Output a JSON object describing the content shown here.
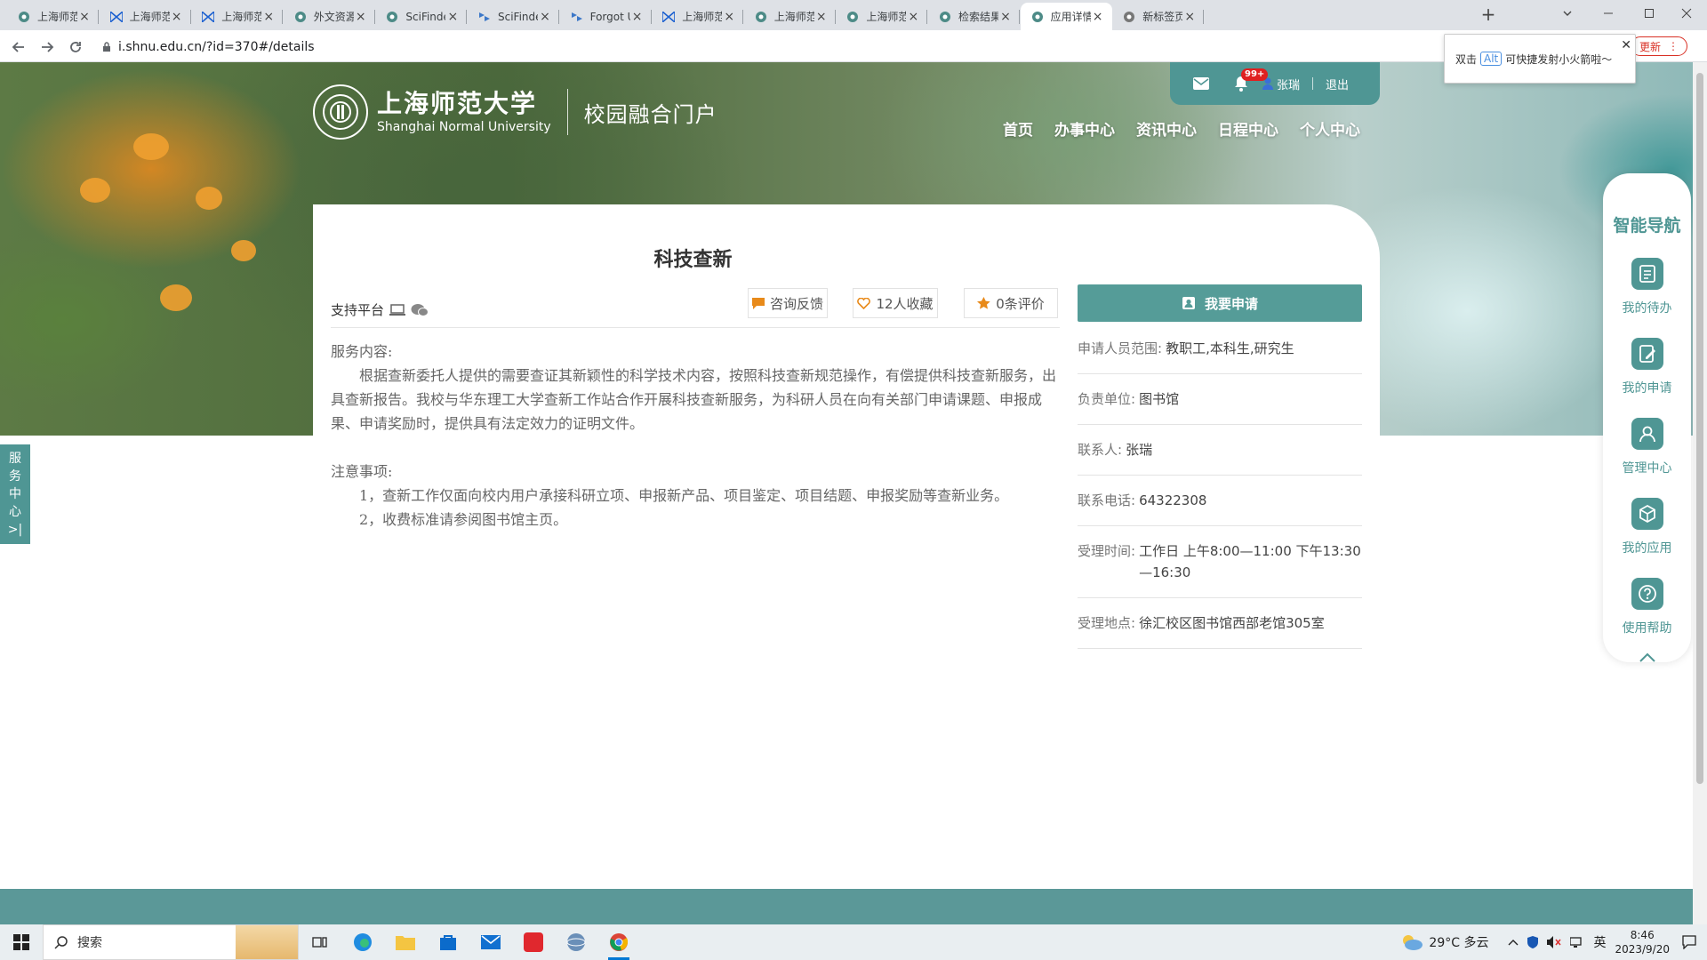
{
  "browser": {
    "tabs": [
      {
        "title": "上海师范大学",
        "icon": "globe-tab-icon"
      },
      {
        "title": "上海师范大学",
        "icon": "bowtie-tab-icon"
      },
      {
        "title": "上海师范大学",
        "icon": "bowtie-tab-icon"
      },
      {
        "title": "外文资源",
        "icon": "globe-tab-icon"
      },
      {
        "title": "SciFinder",
        "icon": "globe-tab-icon"
      },
      {
        "title": "SciFinder",
        "icon": "scifinder-tab-icon"
      },
      {
        "title": "Forgot User",
        "icon": "scifinder-tab-icon"
      },
      {
        "title": "上海师范大学",
        "icon": "bowtie-tab-icon"
      },
      {
        "title": "上海师范大学",
        "icon": "globe-tab-icon"
      },
      {
        "title": "上海师范大学",
        "icon": "globe-tab-icon"
      },
      {
        "title": "检索结果页",
        "icon": "globe-tab-icon"
      },
      {
        "title": "应用详情页",
        "icon": "globe-tab-icon",
        "active": true
      },
      {
        "title": "新标签页",
        "icon": "chrome-tab-icon"
      }
    ],
    "url": "i.shnu.edu.cn/?id=370#/details",
    "update_label": "更新"
  },
  "alt_popup": {
    "prefix": "双击",
    "key": "Alt",
    "suffix": "可快捷发射小火箭啦～"
  },
  "header": {
    "school_cn": "上海师范大学",
    "school_en": "Shanghai Normal University",
    "portal_name": "校园融合门户",
    "notif_badge": "99+",
    "user_name": "张瑞",
    "logout": "退出",
    "nav": [
      "首页",
      "办事中心",
      "资讯中心",
      "日程中心",
      "个人中心"
    ]
  },
  "service": {
    "title": "科技查新",
    "platform_label": "支持平台",
    "consult_label": "咨询反馈",
    "favorites_label": "12人收藏",
    "reviews_label": "0条评价",
    "apply_label": "我要申请",
    "content_heading": "服务内容:",
    "content_body": "根据查新委托人提供的需要查证其新颖性的科学技术内容，按照科技查新规范操作，有偿提供科技查新服务，出具查新报告。我校与华东理工大学查新工作站合作开展科技查新服务，为科研人员在向有关部门申请课题、申报成果、申请奖励时，提供具有法定效力的证明文件。",
    "notes_heading": "注意事项:",
    "note1": "1，查新工作仅面向校内用户承接科研立项、申报新产品、项目鉴定、项目结题、申报奖励等查新业务。",
    "note2": "2，收费标准请参阅图书馆主页。",
    "info": [
      {
        "key": "申请人员范围:",
        "value": "教职工,本科生,研究生"
      },
      {
        "key": "负责单位:",
        "value": "图书馆"
      },
      {
        "key": "联系人:",
        "value": "张瑞"
      },
      {
        "key": "联系电话:",
        "value": "64322308"
      },
      {
        "key": "受理时间:",
        "value": "工作日 上午8:00—11:00 下午13:30—16:30"
      },
      {
        "key": "受理地点:",
        "value": "徐汇校区图书馆西部老馆305室"
      }
    ]
  },
  "side_tab": [
    "服",
    "务",
    "中",
    "心",
    ">|"
  ],
  "smart_nav": {
    "title": "智能导航",
    "items": [
      "我的待办",
      "我的申请",
      "管理中心",
      "我的应用",
      "使用帮助"
    ]
  },
  "taskbar": {
    "search_placeholder": "搜索",
    "weather": "29°C 多云",
    "ime": "英",
    "time": "8:46",
    "date": "2023/9/20"
  },
  "colors": {
    "accent": "#559c98",
    "badge": "#e02020"
  }
}
